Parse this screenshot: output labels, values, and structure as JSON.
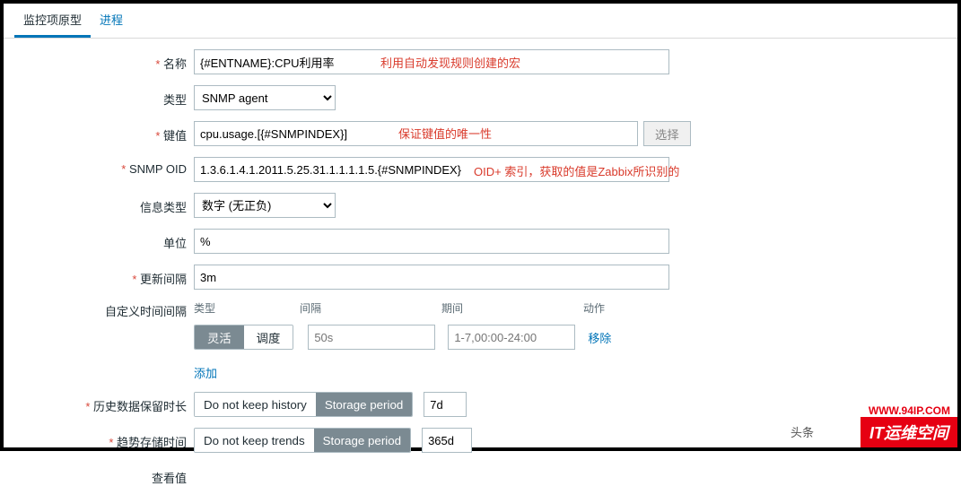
{
  "tabs": {
    "prototype": "监控项原型",
    "process": "进程"
  },
  "labels": {
    "name": "名称",
    "type": "类型",
    "key": "键值",
    "snmp_oid": "SNMP OID",
    "info_type": "信息类型",
    "unit": "单位",
    "update_interval": "更新间隔",
    "custom_interval": "自定义时间间隔",
    "history": "历史数据保留时长",
    "trends": "趋势存储时间",
    "valuemap": "查看值"
  },
  "interval_headers": {
    "type": "类型",
    "interval": "间隔",
    "period": "期间",
    "action": "动作"
  },
  "values": {
    "name": "{#ENTNAME}:CPU利用率",
    "type": "SNMP agent",
    "key": "cpu.usage.[{#SNMPINDEX}]",
    "snmp_oid": "1.3.6.1.4.1.2011.5.25.31.1.1.1.1.5.{#SNMPINDEX}",
    "info_type": "数字 (无正负)",
    "unit": "%",
    "update_interval": "3m",
    "flex_interval": "50s",
    "flex_period": "1-7,00:00-24:00",
    "history_period": "7d",
    "trends_period": "365d"
  },
  "buttons": {
    "select": "选择",
    "flexible": "灵活",
    "scheduling": "调度",
    "remove": "移除",
    "add": "添加",
    "no_history": "Do not keep history",
    "storage_period": "Storage period",
    "no_trends": "Do not keep trends"
  },
  "annotations": {
    "name": "利用自动发现规则创建的宏",
    "key": "保证键值的唯一性",
    "oid": "OID+ 索引，获取的值是Zabbix所识别的"
  },
  "watermark": {
    "url": "WWW.94IP.COM",
    "brand": "IT运维空间",
    "head": "头条"
  }
}
